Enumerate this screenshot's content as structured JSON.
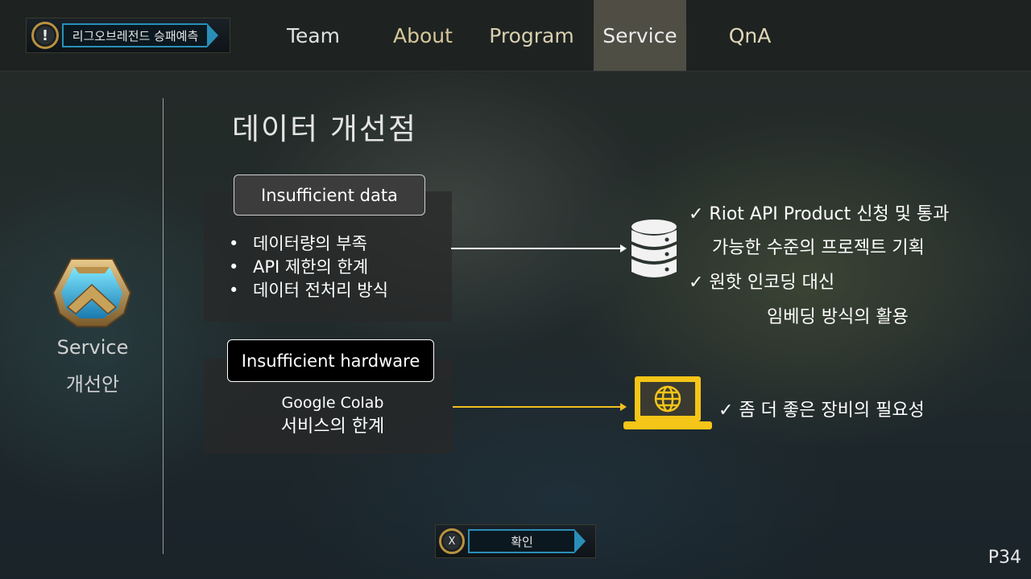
{
  "header": {
    "app_badge_icon": "exclamation",
    "app_title": "리그오브레전드 승패예측",
    "nav": [
      {
        "label": "Team",
        "active": false
      },
      {
        "label": "About",
        "active": false
      },
      {
        "label": "Program",
        "active": false
      },
      {
        "label": "Service",
        "active": true
      },
      {
        "label": "QnA",
        "active": false
      }
    ]
  },
  "sidebar": {
    "emblem_icon": "hextech-emblem-icon",
    "label_line1": "Service",
    "label_line2": "개선안"
  },
  "main": {
    "title": "데이터 개선점",
    "issue1": {
      "tag": "Insufficient data",
      "bullets": [
        "데이터량의 부족",
        "API 제한의 한계",
        "데이터 전처리 방식"
      ],
      "icon": "database-icon",
      "solutions": [
        {
          "line1": "✓ Riot API Product 신청 및 통과",
          "line2": "가능한 수준의 프로젝트 기획"
        },
        {
          "line1": "✓ 원핫 인코딩 대신",
          "line2": "임베딩 방식의 활용"
        }
      ]
    },
    "issue2": {
      "tag": "Insufficient hardware",
      "text_line1": "Google Colab",
      "text_line2": "서비스의 한계",
      "icon": "laptop-globe-icon",
      "solution": "✓ 좀 더 좋은 장비의 필요성"
    }
  },
  "footer": {
    "confirm_icon": "X",
    "confirm_label": "확인",
    "page_number": "P34"
  },
  "colors": {
    "accent_blue": "#2a8fb8",
    "gold": "#b8923f",
    "arrow_yellow": "#f0c020",
    "icon_yellow": "#f5c518"
  }
}
